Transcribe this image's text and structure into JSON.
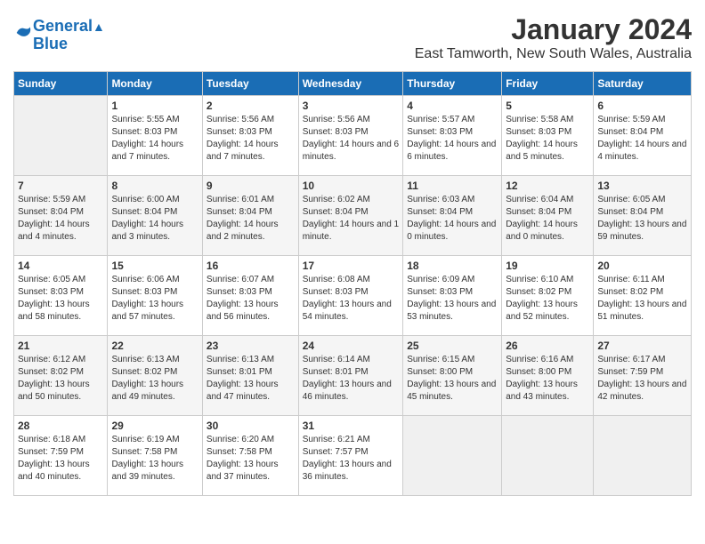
{
  "header": {
    "logo_line1": "General",
    "logo_line2": "Blue",
    "title": "January 2024",
    "subtitle": "East Tamworth, New South Wales, Australia"
  },
  "days_of_week": [
    "Sunday",
    "Monday",
    "Tuesday",
    "Wednesday",
    "Thursday",
    "Friday",
    "Saturday"
  ],
  "weeks": [
    [
      {
        "day": "",
        "sunrise": "",
        "sunset": "",
        "daylight": ""
      },
      {
        "day": "1",
        "sunrise": "Sunrise: 5:55 AM",
        "sunset": "Sunset: 8:03 PM",
        "daylight": "Daylight: 14 hours and 7 minutes."
      },
      {
        "day": "2",
        "sunrise": "Sunrise: 5:56 AM",
        "sunset": "Sunset: 8:03 PM",
        "daylight": "Daylight: 14 hours and 7 minutes."
      },
      {
        "day": "3",
        "sunrise": "Sunrise: 5:56 AM",
        "sunset": "Sunset: 8:03 PM",
        "daylight": "Daylight: 14 hours and 6 minutes."
      },
      {
        "day": "4",
        "sunrise": "Sunrise: 5:57 AM",
        "sunset": "Sunset: 8:03 PM",
        "daylight": "Daylight: 14 hours and 6 minutes."
      },
      {
        "day": "5",
        "sunrise": "Sunrise: 5:58 AM",
        "sunset": "Sunset: 8:03 PM",
        "daylight": "Daylight: 14 hours and 5 minutes."
      },
      {
        "day": "6",
        "sunrise": "Sunrise: 5:59 AM",
        "sunset": "Sunset: 8:04 PM",
        "daylight": "Daylight: 14 hours and 4 minutes."
      }
    ],
    [
      {
        "day": "7",
        "sunrise": "Sunrise: 5:59 AM",
        "sunset": "Sunset: 8:04 PM",
        "daylight": "Daylight: 14 hours and 4 minutes."
      },
      {
        "day": "8",
        "sunrise": "Sunrise: 6:00 AM",
        "sunset": "Sunset: 8:04 PM",
        "daylight": "Daylight: 14 hours and 3 minutes."
      },
      {
        "day": "9",
        "sunrise": "Sunrise: 6:01 AM",
        "sunset": "Sunset: 8:04 PM",
        "daylight": "Daylight: 14 hours and 2 minutes."
      },
      {
        "day": "10",
        "sunrise": "Sunrise: 6:02 AM",
        "sunset": "Sunset: 8:04 PM",
        "daylight": "Daylight: 14 hours and 1 minute."
      },
      {
        "day": "11",
        "sunrise": "Sunrise: 6:03 AM",
        "sunset": "Sunset: 8:04 PM",
        "daylight": "Daylight: 14 hours and 0 minutes."
      },
      {
        "day": "12",
        "sunrise": "Sunrise: 6:04 AM",
        "sunset": "Sunset: 8:04 PM",
        "daylight": "Daylight: 14 hours and 0 minutes."
      },
      {
        "day": "13",
        "sunrise": "Sunrise: 6:05 AM",
        "sunset": "Sunset: 8:04 PM",
        "daylight": "Daylight: 13 hours and 59 minutes."
      }
    ],
    [
      {
        "day": "14",
        "sunrise": "Sunrise: 6:05 AM",
        "sunset": "Sunset: 8:03 PM",
        "daylight": "Daylight: 13 hours and 58 minutes."
      },
      {
        "day": "15",
        "sunrise": "Sunrise: 6:06 AM",
        "sunset": "Sunset: 8:03 PM",
        "daylight": "Daylight: 13 hours and 57 minutes."
      },
      {
        "day": "16",
        "sunrise": "Sunrise: 6:07 AM",
        "sunset": "Sunset: 8:03 PM",
        "daylight": "Daylight: 13 hours and 56 minutes."
      },
      {
        "day": "17",
        "sunrise": "Sunrise: 6:08 AM",
        "sunset": "Sunset: 8:03 PM",
        "daylight": "Daylight: 13 hours and 54 minutes."
      },
      {
        "day": "18",
        "sunrise": "Sunrise: 6:09 AM",
        "sunset": "Sunset: 8:03 PM",
        "daylight": "Daylight: 13 hours and 53 minutes."
      },
      {
        "day": "19",
        "sunrise": "Sunrise: 6:10 AM",
        "sunset": "Sunset: 8:02 PM",
        "daylight": "Daylight: 13 hours and 52 minutes."
      },
      {
        "day": "20",
        "sunrise": "Sunrise: 6:11 AM",
        "sunset": "Sunset: 8:02 PM",
        "daylight": "Daylight: 13 hours and 51 minutes."
      }
    ],
    [
      {
        "day": "21",
        "sunrise": "Sunrise: 6:12 AM",
        "sunset": "Sunset: 8:02 PM",
        "daylight": "Daylight: 13 hours and 50 minutes."
      },
      {
        "day": "22",
        "sunrise": "Sunrise: 6:13 AM",
        "sunset": "Sunset: 8:02 PM",
        "daylight": "Daylight: 13 hours and 49 minutes."
      },
      {
        "day": "23",
        "sunrise": "Sunrise: 6:13 AM",
        "sunset": "Sunset: 8:01 PM",
        "daylight": "Daylight: 13 hours and 47 minutes."
      },
      {
        "day": "24",
        "sunrise": "Sunrise: 6:14 AM",
        "sunset": "Sunset: 8:01 PM",
        "daylight": "Daylight: 13 hours and 46 minutes."
      },
      {
        "day": "25",
        "sunrise": "Sunrise: 6:15 AM",
        "sunset": "Sunset: 8:00 PM",
        "daylight": "Daylight: 13 hours and 45 minutes."
      },
      {
        "day": "26",
        "sunrise": "Sunrise: 6:16 AM",
        "sunset": "Sunset: 8:00 PM",
        "daylight": "Daylight: 13 hours and 43 minutes."
      },
      {
        "day": "27",
        "sunrise": "Sunrise: 6:17 AM",
        "sunset": "Sunset: 7:59 PM",
        "daylight": "Daylight: 13 hours and 42 minutes."
      }
    ],
    [
      {
        "day": "28",
        "sunrise": "Sunrise: 6:18 AM",
        "sunset": "Sunset: 7:59 PM",
        "daylight": "Daylight: 13 hours and 40 minutes."
      },
      {
        "day": "29",
        "sunrise": "Sunrise: 6:19 AM",
        "sunset": "Sunset: 7:58 PM",
        "daylight": "Daylight: 13 hours and 39 minutes."
      },
      {
        "day": "30",
        "sunrise": "Sunrise: 6:20 AM",
        "sunset": "Sunset: 7:58 PM",
        "daylight": "Daylight: 13 hours and 37 minutes."
      },
      {
        "day": "31",
        "sunrise": "Sunrise: 6:21 AM",
        "sunset": "Sunset: 7:57 PM",
        "daylight": "Daylight: 13 hours and 36 minutes."
      },
      {
        "day": "",
        "sunrise": "",
        "sunset": "",
        "daylight": ""
      },
      {
        "day": "",
        "sunrise": "",
        "sunset": "",
        "daylight": ""
      },
      {
        "day": "",
        "sunrise": "",
        "sunset": "",
        "daylight": ""
      }
    ]
  ]
}
